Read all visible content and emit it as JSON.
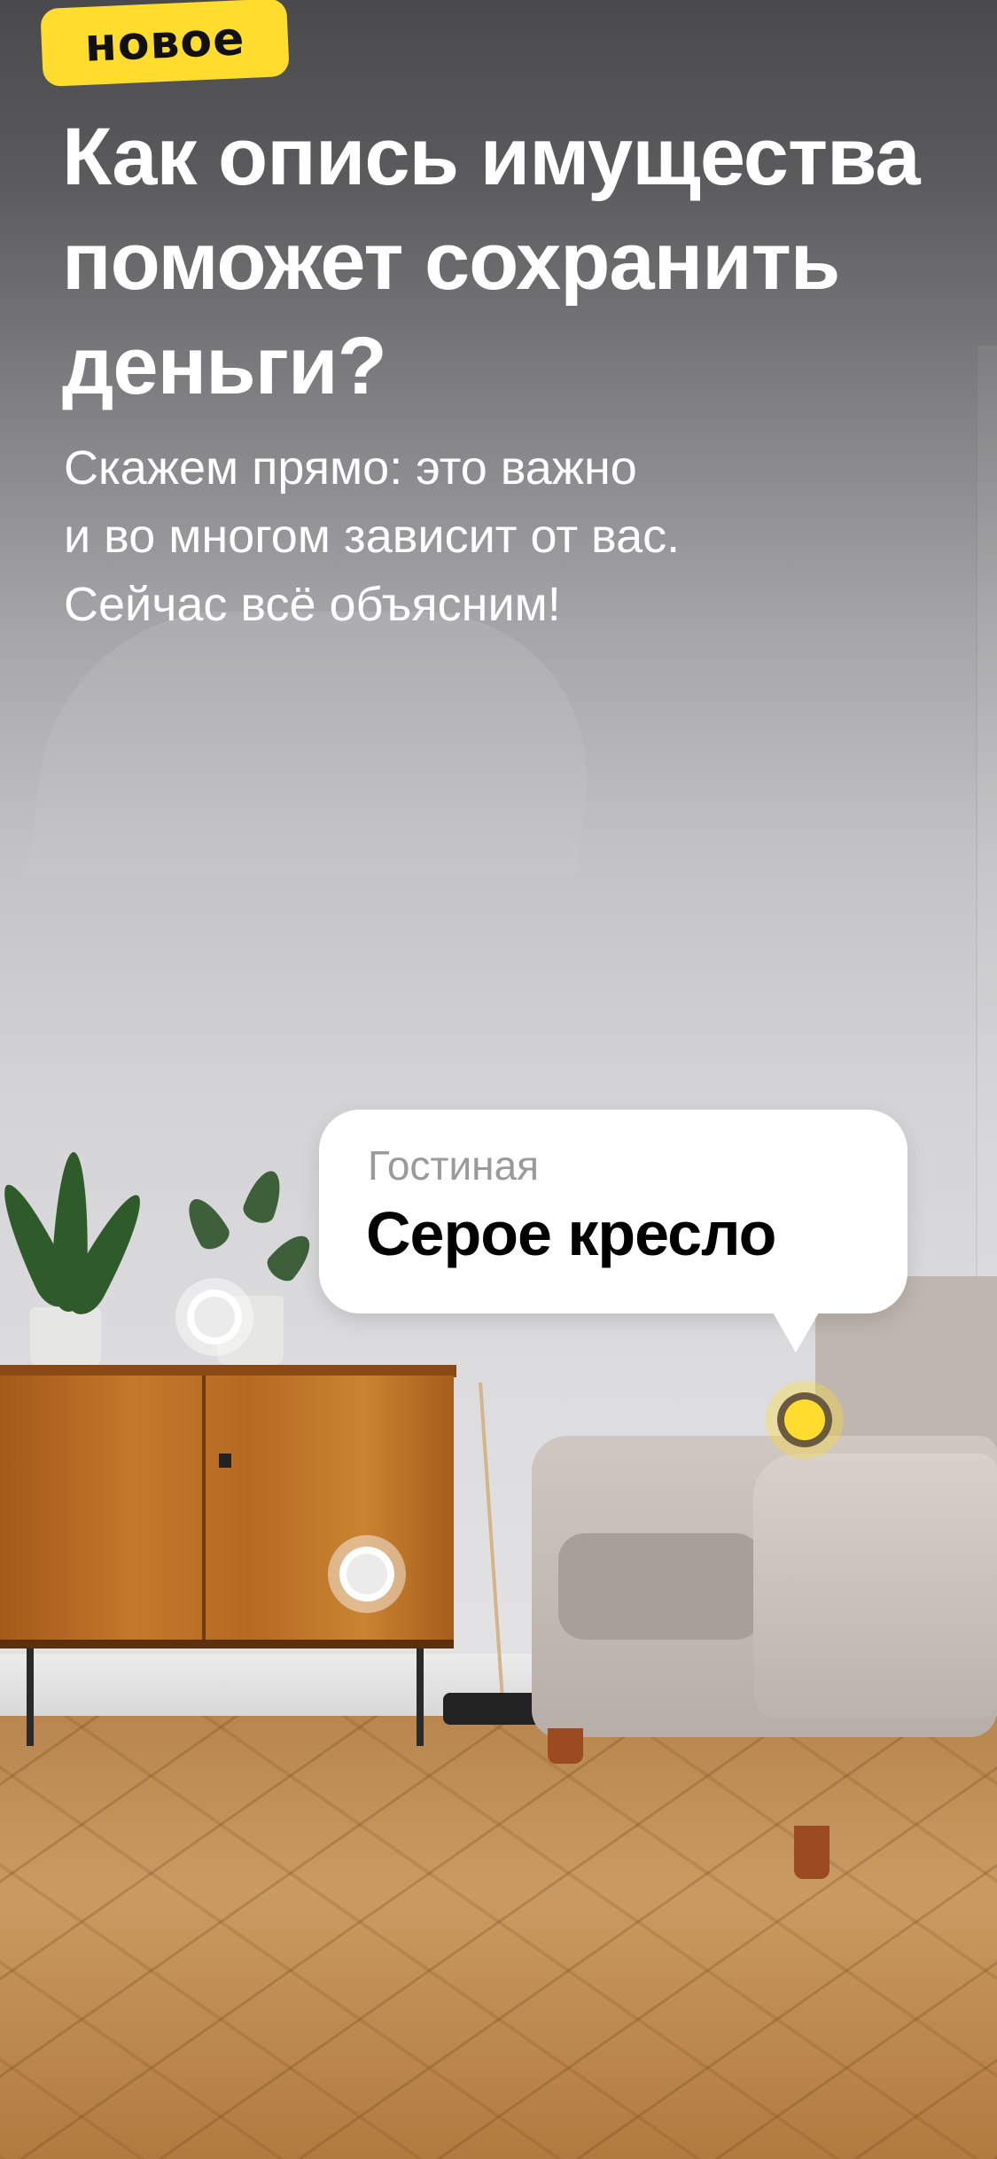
{
  "badge": {
    "label": "новое"
  },
  "title": {
    "line1": "Как опись имущества",
    "line2": "поможет сохранить",
    "line3": "деньги?"
  },
  "subtitle": {
    "line1": "Скажем прямо: это важно",
    "line2": "и во многом зависит от вас.",
    "line3": "Сейчас всё объясним!"
  },
  "tooltip": {
    "room": "Гостиная",
    "item": "Серое кресло"
  },
  "hotspots": [
    {
      "name": "plant-pot",
      "active": false
    },
    {
      "name": "cabinet",
      "active": false
    },
    {
      "name": "armchair",
      "active": true
    }
  ],
  "colors": {
    "accent": "#ffdc2e",
    "text_light": "#ffffff",
    "tooltip_secondary": "#9a9a9a"
  }
}
